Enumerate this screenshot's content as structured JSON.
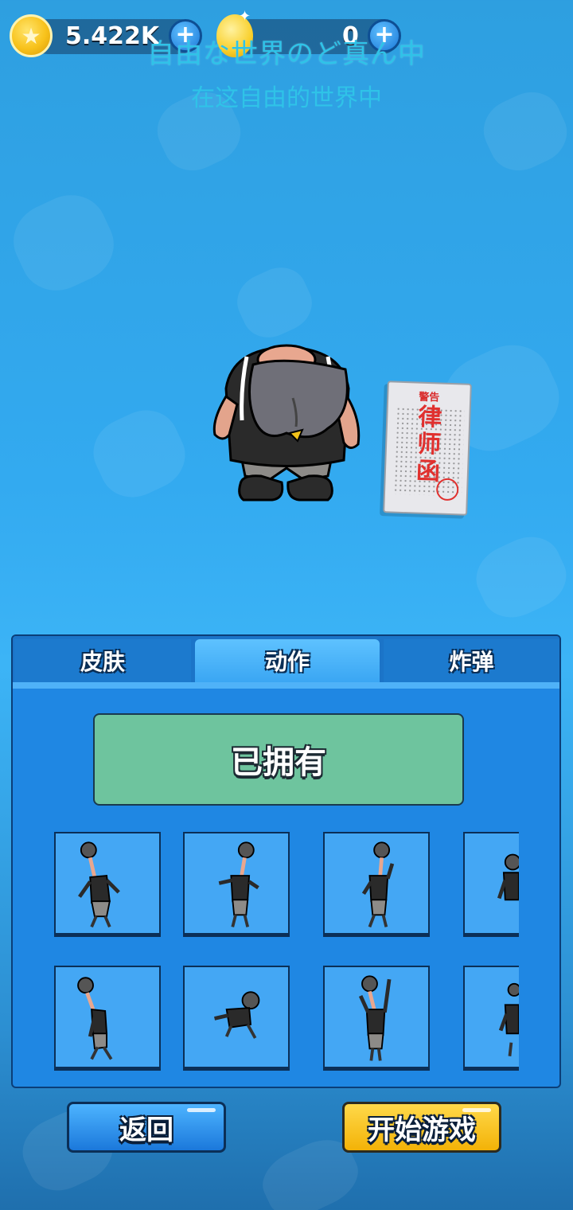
{
  "header": {
    "coin_value": "5.422K",
    "gem_value": "0",
    "title_jp": "自由な世界のど真ん中",
    "title_cn": "在这自由的世界中"
  },
  "preview": {
    "letter_small": "警告",
    "letter_big": "律师函"
  },
  "panel": {
    "tabs": [
      {
        "label": "皮肤",
        "active": false
      },
      {
        "label": "动作",
        "active": true
      },
      {
        "label": "炸弹",
        "active": false
      }
    ],
    "owned_label": "已拥有",
    "actions": [
      {
        "pose": "dance"
      },
      {
        "pose": "point"
      },
      {
        "pose": "wave"
      },
      {
        "pose": "partial"
      },
      {
        "pose": "lean"
      },
      {
        "pose": "crouch"
      },
      {
        "pose": "arms-up"
      },
      {
        "pose": "partial"
      }
    ]
  },
  "buttons": {
    "back_label": "返回",
    "start_label": "开始游戏"
  },
  "colors": {
    "accent_blue": "#1f87e3",
    "owned_green": "#6ec49e",
    "start_yellow": "#f3b207",
    "title_cyan": "#2fc3e8"
  },
  "icons": [
    "coin-icon",
    "plus-icon",
    "gem-icon",
    "letter-icon"
  ]
}
